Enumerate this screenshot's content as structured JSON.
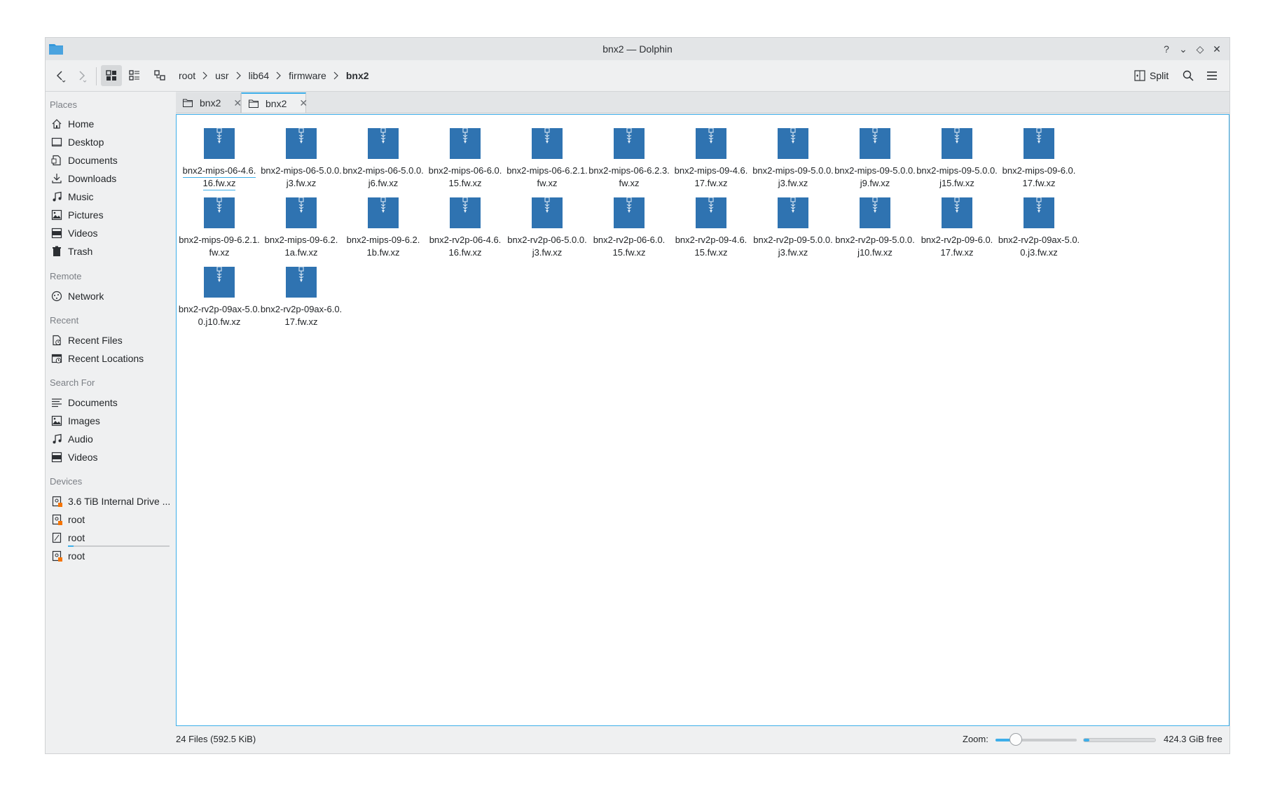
{
  "window": {
    "title": "bnx2 — Dolphin",
    "controls": [
      "?",
      "⌄",
      "◇",
      "✕"
    ]
  },
  "toolbar": {
    "breadcrumb": [
      "root",
      "usr",
      "lib64",
      "firmware",
      "bnx2"
    ],
    "split_label": "Split"
  },
  "sidebar": {
    "sections": [
      {
        "title": "Places",
        "items": [
          {
            "label": "Home",
            "icon": "home-icon"
          },
          {
            "label": "Desktop",
            "icon": "desktop-icon"
          },
          {
            "label": "Documents",
            "icon": "documents-icon"
          },
          {
            "label": "Downloads",
            "icon": "downloads-icon"
          },
          {
            "label": "Music",
            "icon": "music-icon"
          },
          {
            "label": "Pictures",
            "icon": "pictures-icon"
          },
          {
            "label": "Videos",
            "icon": "videos-icon"
          },
          {
            "label": "Trash",
            "icon": "trash-icon"
          }
        ]
      },
      {
        "title": "Remote",
        "items": [
          {
            "label": "Network",
            "icon": "network-icon"
          }
        ]
      },
      {
        "title": "Recent",
        "items": [
          {
            "label": "Recent Files",
            "icon": "recent-files-icon"
          },
          {
            "label": "Recent Locations",
            "icon": "recent-locations-icon"
          }
        ]
      },
      {
        "title": "Search For",
        "items": [
          {
            "label": "Documents",
            "icon": "search-documents-icon"
          },
          {
            "label": "Images",
            "icon": "images-icon"
          },
          {
            "label": "Audio",
            "icon": "audio-icon"
          },
          {
            "label": "Videos",
            "icon": "videos-icon"
          }
        ]
      },
      {
        "title": "Devices",
        "items": [
          {
            "label": "3.6 TiB Internal Drive ...",
            "icon": "drive-icon"
          },
          {
            "label": "root",
            "icon": "drive-icon"
          },
          {
            "label": "root",
            "icon": "drive-icon"
          },
          {
            "label": "root",
            "icon": "drive-icon"
          }
        ]
      }
    ]
  },
  "tabs": [
    {
      "label": "bnx2",
      "active": false
    },
    {
      "label": "bnx2",
      "active": true
    }
  ],
  "files": [
    "bnx2-mips-06-4.6.16.fw.xz",
    "bnx2-mips-06-5.0.0.j3.fw.xz",
    "bnx2-mips-06-5.0.0.j6.fw.xz",
    "bnx2-mips-06-6.0.15.fw.xz",
    "bnx2-mips-06-6.2.1.fw.xz",
    "bnx2-mips-06-6.2.3.fw.xz",
    "bnx2-mips-09-4.6.17.fw.xz",
    "bnx2-mips-09-5.0.0.j3.fw.xz",
    "bnx2-mips-09-5.0.0.j9.fw.xz",
    "bnx2-mips-09-5.0.0.j15.fw.xz",
    "bnx2-mips-09-6.0.17.fw.xz",
    "bnx2-mips-09-6.2.1.fw.xz",
    "bnx2-mips-09-6.2.1a.fw.xz",
    "bnx2-mips-09-6.2.1b.fw.xz",
    "bnx2-rv2p-06-4.6.16.fw.xz",
    "bnx2-rv2p-06-5.0.0.j3.fw.xz",
    "bnx2-rv2p-06-6.0.15.fw.xz",
    "bnx2-rv2p-09-4.6.15.fw.xz",
    "bnx2-rv2p-09-5.0.0.j3.fw.xz",
    "bnx2-rv2p-09-5.0.0.j10.fw.xz",
    "bnx2-rv2p-09-6.0.17.fw.xz",
    "bnx2-rv2p-09ax-5.0.0.j3.fw.xz",
    "bnx2-rv2p-09ax-5.0.0.j10.fw.xz",
    "bnx2-rv2p-09ax-6.0.17.fw.xz"
  ],
  "file_lines": [
    [
      "bnx2-mips-06-4.6.",
      "16.fw.xz"
    ],
    [
      "bnx2-mips-06-5.0.0.",
      "j3.fw.xz"
    ],
    [
      "bnx2-mips-06-5.0.0.",
      "j6.fw.xz"
    ],
    [
      "bnx2-mips-06-6.0.",
      "15.fw.xz"
    ],
    [
      "bnx2-mips-06-6.2.1.",
      "fw.xz"
    ],
    [
      "bnx2-mips-06-6.2.3.",
      "fw.xz"
    ],
    [
      "bnx2-mips-09-4.6.",
      "17.fw.xz"
    ],
    [
      "bnx2-mips-09-5.0.0.",
      "j3.fw.xz"
    ],
    [
      "bnx2-mips-09-5.0.0.",
      "j9.fw.xz"
    ],
    [
      "bnx2-mips-09-5.0.0.",
      "j15.fw.xz"
    ],
    [
      "bnx2-mips-09-6.0.",
      "17.fw.xz"
    ],
    [
      "bnx2-mips-09-6.2.1.",
      "fw.xz"
    ],
    [
      "bnx2-mips-09-6.2.",
      "1a.fw.xz"
    ],
    [
      "bnx2-mips-09-6.2.",
      "1b.fw.xz"
    ],
    [
      "bnx2-rv2p-06-4.6.",
      "16.fw.xz"
    ],
    [
      "bnx2-rv2p-06-5.0.0.",
      "j3.fw.xz"
    ],
    [
      "bnx2-rv2p-06-6.0.",
      "15.fw.xz"
    ],
    [
      "bnx2-rv2p-09-4.6.",
      "15.fw.xz"
    ],
    [
      "bnx2-rv2p-09-5.0.0.",
      "j3.fw.xz"
    ],
    [
      "bnx2-rv2p-09-5.0.0.",
      "j10.fw.xz"
    ],
    [
      "bnx2-rv2p-09-6.0.",
      "17.fw.xz"
    ],
    [
      "bnx2-rv2p-09ax-5.0.",
      "0.j3.fw.xz"
    ],
    [
      "bnx2-rv2p-09ax-5.0.",
      "0.j10.fw.xz"
    ],
    [
      "bnx2-rv2p-09ax-6.0.",
      "17.fw.xz"
    ]
  ],
  "status": {
    "file_count": "24 Files (592.5 KiB)",
    "zoom_label": "Zoom:",
    "zoom_level": 0.25,
    "space_used_fraction": 0.08,
    "free_space": "424.3 GiB free"
  },
  "colors": {
    "accent": "#3daee9",
    "archive_icon": "#2f73b1"
  }
}
